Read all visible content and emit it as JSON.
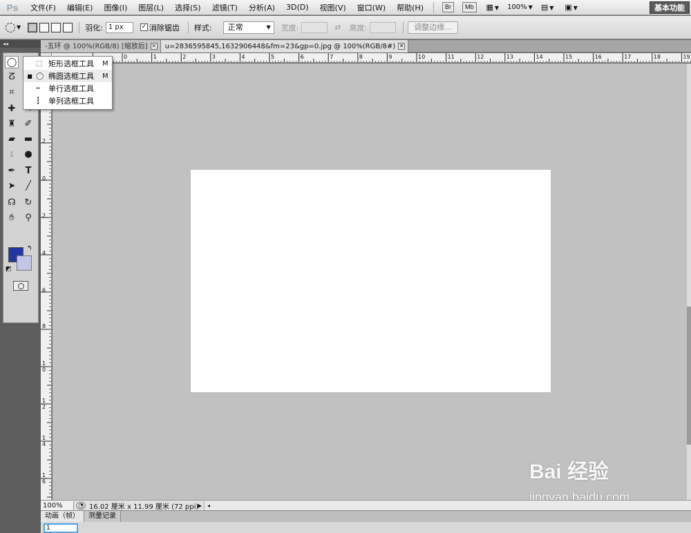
{
  "menubar": {
    "logo": "Ps",
    "items": [
      "文件(F)",
      "编辑(E)",
      "图像(I)",
      "图层(L)",
      "选择(S)",
      "滤镜(T)",
      "分析(A)",
      "3D(D)",
      "视图(V)",
      "窗口(W)",
      "帮助(H)"
    ],
    "bridge_label": "Br",
    "minibridge_label": "Mb",
    "zoom": "100%",
    "workspace": "基本功能"
  },
  "options": {
    "feather_label": "羽化:",
    "feather_value": "1 px",
    "antialias_checked": "✓",
    "antialias_label": "消除锯齿",
    "style_label": "样式:",
    "style_value": "正常",
    "width_label": "宽度:",
    "height_label": "高度:",
    "refine_edge": "调整边缘..."
  },
  "tabs": [
    {
      "label": "-五环 @ 100%(RGB/8) [缩放后]",
      "close": "✕"
    },
    {
      "label": "u=2836595845,1632906448&fm=23&gp=0.jpg @ 100%(RGB/8#)",
      "close": "✕"
    }
  ],
  "flyout": {
    "items": [
      {
        "label": "矩形选框工具",
        "key": "M",
        "bullet": "",
        "glyph": "⬚"
      },
      {
        "label": "椭圆选框工具",
        "key": "M",
        "bullet": "■",
        "glyph": "◯"
      },
      {
        "label": "单行选框工具",
        "key": "",
        "bullet": "",
        "glyph": "┅"
      },
      {
        "label": "单列选框工具",
        "key": "",
        "bullet": "",
        "glyph": "┇"
      }
    ]
  },
  "ruler": {
    "h": [
      "0",
      "1",
      "2",
      "3",
      "4",
      "5",
      "6",
      "7",
      "8",
      "9",
      "10",
      "11",
      "12",
      "13",
      "14",
      "15",
      "16",
      "17",
      "18",
      "19",
      "20",
      "21",
      "22"
    ],
    "v": [
      "0",
      "2",
      "0",
      "2",
      "4",
      "6",
      "8",
      "1\n0",
      "1\n2",
      "1\n4",
      "1\n6"
    ]
  },
  "colors": {
    "foreground": "#2436a0",
    "background": "#c3c6e5"
  },
  "status": {
    "zoom": "100%",
    "doc_size": "16.02 厘米 x 11.99 厘米 (72 ppi)"
  },
  "panels": {
    "tabs": [
      "动画（帧）",
      "测量记录"
    ],
    "frame": "1"
  },
  "watermark": {
    "logo": "Bai 经验",
    "url": "jingyan.baidu.com"
  }
}
